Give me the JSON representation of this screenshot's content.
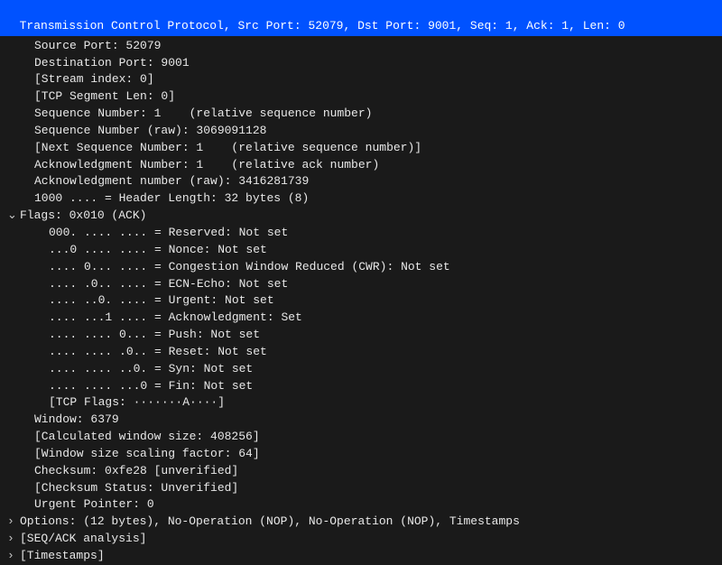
{
  "header": "Transmission Control Protocol, Src Port: 52079, Dst Port: 9001, Seq: 1, Ack: 1, Len: 0",
  "fields": {
    "src_port": "Source Port: 52079",
    "dst_port": "Destination Port: 9001",
    "stream_index": "[Stream index: 0]",
    "seg_len": "[TCP Segment Len: 0]",
    "seq_rel": "Sequence Number: 1    (relative sequence number)",
    "seq_raw": "Sequence Number (raw): 3069091128",
    "next_seq": "[Next Sequence Number: 1    (relative sequence number)]",
    "ack_rel": "Acknowledgment Number: 1    (relative ack number)",
    "ack_raw": "Acknowledgment number (raw): 3416281739",
    "hdr_len": "1000 .... = Header Length: 32 bytes (8)",
    "flags_summary": "Flags: 0x010 (ACK)",
    "flag_reserved": "000. .... .... = Reserved: Not set",
    "flag_nonce": "...0 .... .... = Nonce: Not set",
    "flag_cwr": ".... 0... .... = Congestion Window Reduced (CWR): Not set",
    "flag_ecn": ".... .0.. .... = ECN-Echo: Not set",
    "flag_urg": ".... ..0. .... = Urgent: Not set",
    "flag_ack": ".... ...1 .... = Acknowledgment: Set",
    "flag_psh": ".... .... 0... = Push: Not set",
    "flag_rst": ".... .... .0.. = Reset: Not set",
    "flag_syn": ".... .... ..0. = Syn: Not set",
    "flag_fin": ".... .... ...0 = Fin: Not set",
    "tcp_flags_str": "[TCP Flags: ·······A····]",
    "window": "Window: 6379",
    "calc_win": "[Calculated window size: 408256]",
    "win_scale": "[Window size scaling factor: 64]",
    "checksum": "Checksum: 0xfe28 [unverified]",
    "checksum_status": "[Checksum Status: Unverified]",
    "urg_ptr": "Urgent Pointer: 0",
    "options": "Options: (12 bytes), No-Operation (NOP), No-Operation (NOP), Timestamps",
    "seq_ack_analysis": "[SEQ/ACK analysis]",
    "timestamps": "[Timestamps]"
  },
  "chevrons": {
    "expanded": "⌄",
    "collapsed": "›"
  }
}
